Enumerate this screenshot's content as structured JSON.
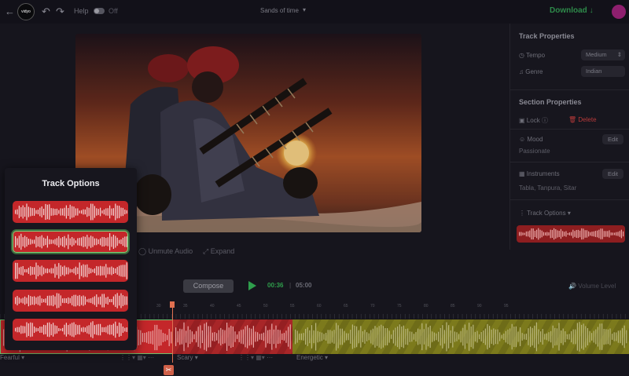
{
  "topbar": {
    "back_icon": "arrow-left-icon",
    "logo_text": "vidyo",
    "undo_icon": "undo-icon",
    "redo_icon": "redo-icon",
    "help_label": "Help",
    "help_state": "Off",
    "project_title": "Sands of time",
    "download_label": "Download",
    "download_icon": "arrow-down-icon"
  },
  "video_controls": {
    "unmute_label": "Unmute Audio",
    "expand_label": "Expand"
  },
  "track_properties": {
    "heading": "Track Properties",
    "tempo_label": "Tempo",
    "tempo_value": "Medium",
    "genre_label": "Genre",
    "genre_value": "Indian"
  },
  "section_properties": {
    "heading": "Section Properties",
    "lock_label": "Lock",
    "delete_label": "Delete",
    "mood_label": "Mood",
    "mood_value": "Passionate",
    "mood_edit": "Edit",
    "instruments_label": "Instruments",
    "instruments_value": "Tabla, Tanpura, Sitar",
    "instruments_edit": "Edit",
    "track_options_label": "Track Options"
  },
  "track_options_popover": {
    "title": "Track Options",
    "selected_index": 1,
    "count": 5
  },
  "transport": {
    "compose_label": "Compose",
    "current_time": "00:36",
    "separator": "|",
    "total_time": "05:00",
    "volume_label": "Volume Level"
  },
  "ruler": {
    "ticks": [
      "30",
      "35",
      "40",
      "45",
      "50",
      "55",
      "60",
      "65",
      "70",
      "75",
      "80",
      "85",
      "90",
      "95"
    ]
  },
  "timeline": {
    "segments": [
      {
        "label": "Fearful",
        "color": "#c4272a"
      },
      {
        "label": "Scary",
        "color": "#a82628"
      },
      {
        "label": "Energetic",
        "color": "#7c7a1c"
      }
    ]
  },
  "colors": {
    "accent_green": "#2f9e4c",
    "track_red": "#c4272a",
    "playhead": "#e07050",
    "delete_red": "#b83a3a"
  }
}
